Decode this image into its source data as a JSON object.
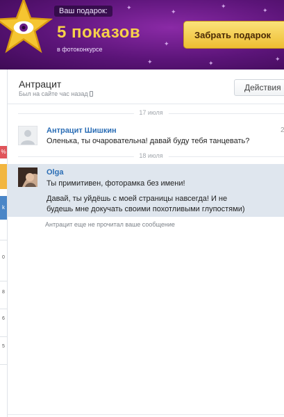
{
  "banner": {
    "gift_label": "Ваш подарок:",
    "shows": "5 показов",
    "contest": "в фотоконкурсе",
    "get_gift_button": "Забрать подарок"
  },
  "sidebar": {
    "badges": [
      "%",
      "k"
    ],
    "numbers": [
      "0",
      "8",
      "6",
      "5"
    ]
  },
  "header": {
    "contact_name": "Антрацит",
    "last_seen": "Был на сайте час назад",
    "actions_button": "Действия"
  },
  "dialog": {
    "date_1": "17 июля",
    "date_2": "18 июля",
    "messages": [
      {
        "author": "Антрацит Шишкин",
        "text": "Оленька, ты очаровательна! давай буду тебя танцевать?",
        "time": "2"
      },
      {
        "author": "Olga",
        "text_1": "Ты примитивен, фоторамка без имени!",
        "text_2": "Давай, ты уйдёшь с моей страницы навсегда! И не будешь мне докучать своими похотливыми глупостями)"
      }
    ],
    "unread_notice": "Антрацит еще не прочитал ваше сообщение"
  },
  "colors": {
    "banner_bg": "#5b1478",
    "accent_gold": "#f7d14a",
    "link_blue": "#2a6db5",
    "highlight_row": "#dfe6ee"
  },
  "icons": [
    "star-eye-icon",
    "phone-icon",
    "chevron-down-icon",
    "avatar-placeholder-icon"
  ]
}
